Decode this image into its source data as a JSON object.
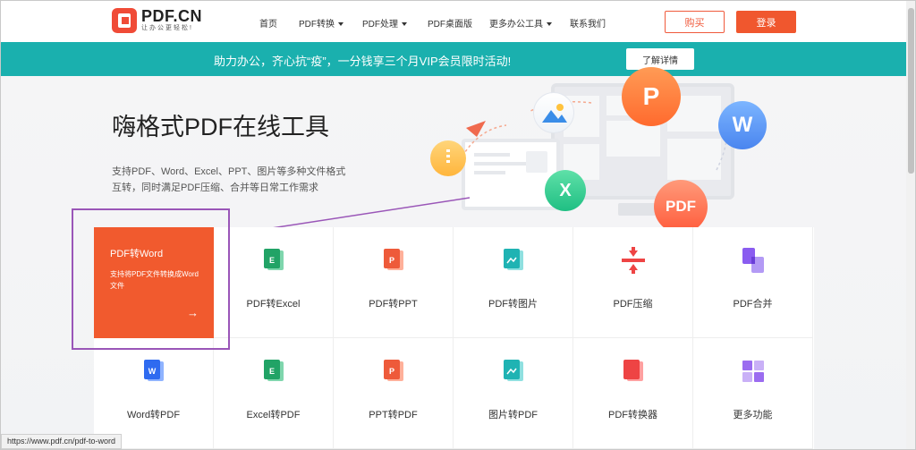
{
  "header": {
    "logo_name": "PDF.CN",
    "logo_slogan": "让办公更轻松!",
    "nav": [
      {
        "label": "首页"
      },
      {
        "label": "PDF转换"
      },
      {
        "label": "PDF处理"
      },
      {
        "label": "PDF桌面版"
      },
      {
        "label": "更多办公工具"
      },
      {
        "label": "联系我们"
      }
    ],
    "buy_label": "购买",
    "login_label": "登录"
  },
  "banner": {
    "text": "助力办公，齐心抗“疫”，一分钱享三个月VIP会员限时活动!",
    "button_label": "了解详情",
    "color": "#1ab0ae"
  },
  "hero": {
    "title": "嗨格式PDF在线工具",
    "desc_line1": "支持PDF、Word、Excel、PPT、图片等多种文件格式",
    "desc_line2": "互转，同时满足PDF压缩、合并等日常工作需求",
    "badges": {
      "p": "P",
      "w": "W",
      "x": "X",
      "pdf": "PDF"
    }
  },
  "featured": {
    "title": "PDF转Word",
    "desc": "支持将PDF文件转换成Word文件",
    "arrow": "→"
  },
  "tools_row1": [
    {
      "label": "PDF转Excel",
      "icon": "excel-doc-icon",
      "letter": "E",
      "color": "#21a366"
    },
    {
      "label": "PDF转PPT",
      "icon": "ppt-doc-icon",
      "letter": "P",
      "color": "#ee5a3a"
    },
    {
      "label": "PDF转图片",
      "icon": "image-doc-icon",
      "letter": "",
      "color": "#1fb3b3"
    },
    {
      "label": "PDF压缩",
      "icon": "compress-icon",
      "letter": "",
      "color": "#ee4444"
    },
    {
      "label": "PDF合并",
      "icon": "merge-icon",
      "letter": "",
      "color": "#8a5cf0"
    }
  ],
  "tools_row2": [
    {
      "label": "Word转PDF",
      "icon": "word-doc-icon",
      "letter": "W",
      "color": "#2f6bf0"
    },
    {
      "label": "Excel转PDF",
      "icon": "excel-doc-icon",
      "letter": "E",
      "color": "#21a366"
    },
    {
      "label": "PPT转PDF",
      "icon": "ppt-doc-icon",
      "letter": "P",
      "color": "#ee5a3a"
    },
    {
      "label": "图片转PDF",
      "icon": "image-doc-icon",
      "letter": "",
      "color": "#1fb3b3"
    },
    {
      "label": "PDF转换器",
      "icon": "converter-icon",
      "letter": "",
      "color": "#ee4444"
    },
    {
      "label": "更多功能",
      "icon": "grid-apps-icon",
      "letter": "",
      "color": "#9b6cf0"
    }
  ],
  "status_url": "https://www.pdf.cn/pdf-to-word",
  "colors": {
    "accent": "#f15a2e",
    "highlight": "#9a56b8"
  }
}
